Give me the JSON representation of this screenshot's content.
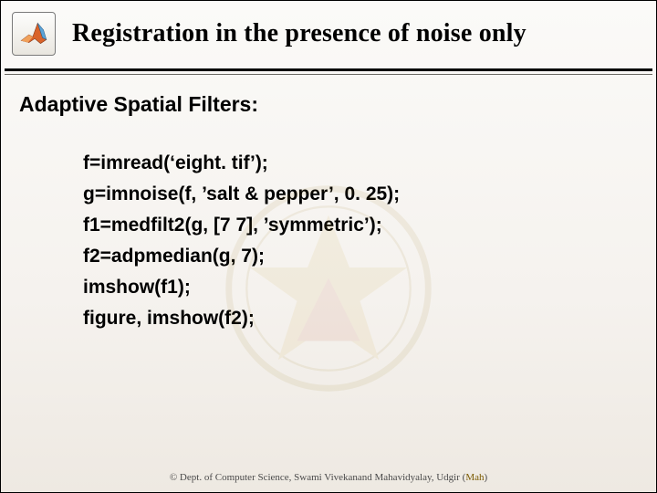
{
  "header": {
    "title": "Registration in the presence of noise only",
    "icon": "matlab-membrane-icon"
  },
  "section_title": "Adaptive Spatial Filters:",
  "code_lines": [
    "f=imread(‘eight. tif’);",
    "g=imnoise(f, ’salt & pepper’, 0. 25);",
    "f1=medfilt2(g, [7 7], ’symmetric’);",
    "f2=adpmedian(g, 7);",
    "imshow(f1);",
    "figure, imshow(f2);"
  ],
  "footer": {
    "prefix": "© Dept. of Computer Science, Swami Vivekanand Mahavidyalay, Udgir (",
    "highlight": "Mah",
    "suffix": ")"
  }
}
